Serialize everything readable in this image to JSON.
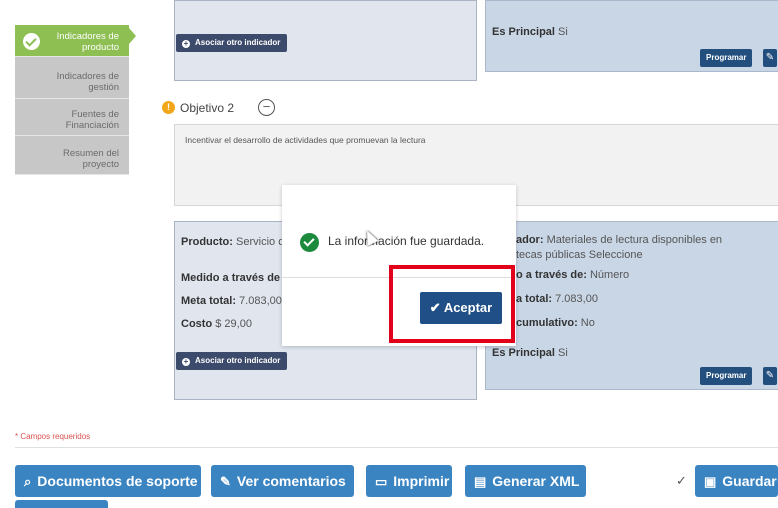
{
  "sidebar": {
    "items": [
      {
        "label": "Indicadores de producto",
        "line1": "Indicadores de",
        "line2": "producto"
      },
      {
        "label": "Indicadores de gestión",
        "line1": "Indicadores de",
        "line2": "gestión"
      },
      {
        "label": "Fuentes de Financiación",
        "line1": "Fuentes de",
        "line2": "Financiación"
      },
      {
        "label": "Resumen del proyecto",
        "line1": "Resumen del",
        "line2": "proyecto"
      }
    ]
  },
  "top": {
    "add_indicator_label": "Asociar otro indicador",
    "es_principal_label": "Es Principal",
    "es_principal_value": "Si",
    "programar_label": "Programar"
  },
  "objetivo": {
    "title": "Objetivo 2",
    "text": "Incentivar el desarrollo de actividades que promuevan la lectura"
  },
  "product": {
    "producto_label": "Producto:",
    "producto_value": "Servicio d",
    "medido_label": "Medido a través de",
    "meta_label": "Meta total:",
    "meta_value": "7.083,00",
    "costo_label": "Costo",
    "costo_value": "$ 29,00",
    "add_indicator_label": "Asociar otro indicador"
  },
  "indicator": {
    "line1_label": "ador:",
    "line1_value": "Materiales de lectura disponibles en",
    "line2": "tecas públicas Seleccione",
    "medido_label": "o a través de:",
    "medido_value": "Número",
    "total_label": "a total:",
    "total_value": "7.083,00",
    "acum_label": "cumulativo:",
    "acum_value": "No",
    "es_principal_label": "Es Principal",
    "es_principal_value": "Si",
    "programar_label": "Programar"
  },
  "modal": {
    "message": "La información fue guardada.",
    "accept_label": "Aceptar"
  },
  "required_note": "* Campos requeridos",
  "toolbar": {
    "docs_label": "Documentos de soporte",
    "comments_label": "Ver comentarios",
    "print_label": "Imprimir",
    "xml_label": "Generar XML",
    "save_label": "Guardar"
  },
  "colors": {
    "sidebar_active": "#8dbf52",
    "toolbar_button": "#3b84c2",
    "accept_button": "#1f4f86",
    "highlight_box": "#e3001b",
    "success_icon": "#1c8a3c"
  }
}
